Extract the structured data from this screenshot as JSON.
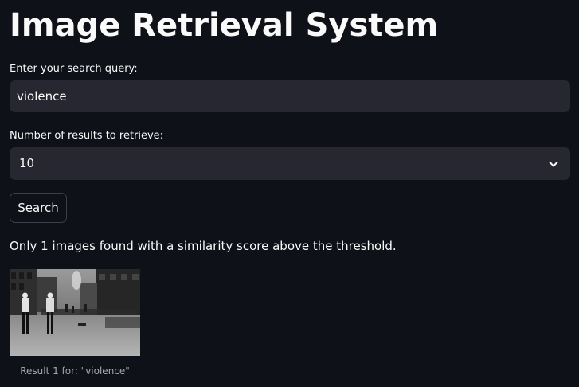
{
  "app": {
    "title": "Image Retrieval System"
  },
  "query": {
    "label": "Enter your search query:",
    "value": "violence"
  },
  "results_count": {
    "label": "Number of results to retrieve:",
    "selected": "10"
  },
  "search_button": {
    "label": "Search"
  },
  "status": {
    "message": "Only 1 images found with a similarity score above the threshold."
  },
  "results": [
    {
      "caption": "Result 1 for: \"violence\"",
      "image_description_icon": "street-scene-photo"
    }
  ],
  "colors": {
    "background": "#0e1117",
    "input_background": "#262730",
    "text": "#fafafa",
    "caption_text": "#a3a8b4",
    "button_border": "#3d4049"
  }
}
